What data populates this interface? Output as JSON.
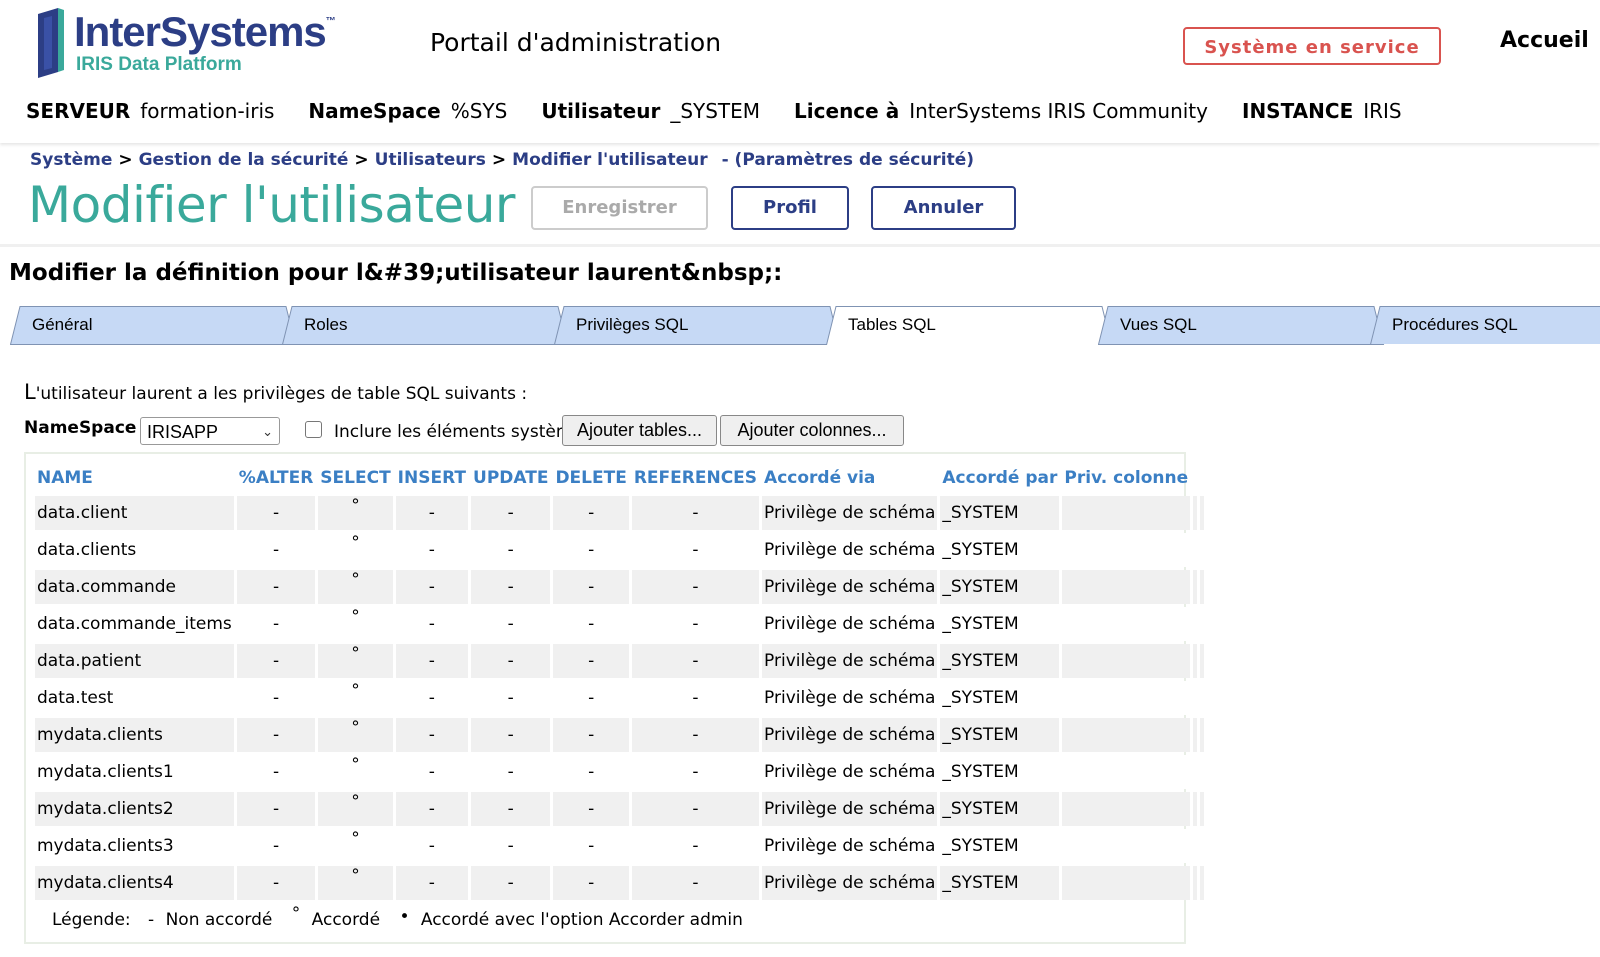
{
  "header": {
    "logo_name": "InterSystems",
    "logo_tm": "™",
    "logo_sub": "IRIS Data Platform",
    "portal_title": "Portail d'administration",
    "status_button": "Système en service",
    "home_link": "Accueil"
  },
  "info": [
    {
      "label": "SERVEUR",
      "value": "formation-iris"
    },
    {
      "label": "NameSpace",
      "value": "%SYS"
    },
    {
      "label": "Utilisateur",
      "value": "_SYSTEM"
    },
    {
      "label": "Licence à",
      "value": "InterSystems IRIS Community"
    },
    {
      "label": "INSTANCE",
      "value": "IRIS"
    }
  ],
  "breadcrumb": {
    "items": [
      "Système",
      "Gestion de la sécurité",
      "Utilisateurs",
      "Modifier l'utilisateur"
    ],
    "separator": ">",
    "suffix": "- (Paramètres de sécurité)"
  },
  "page_title": "Modifier l'utilisateur",
  "commands": {
    "save": "Enregistrer",
    "profile": "Profil",
    "cancel": "Annuler"
  },
  "definition_title": "Modifier la définition pour l&#39;utilisateur laurent&nbsp;:",
  "tabs": [
    "Général",
    "Roles",
    "Privilèges SQL",
    "Tables SQL",
    "Vues SQL",
    "Procédures SQL"
  ],
  "active_tab": "Tables SQL",
  "intro": {
    "first": "L",
    "rest": "'utilisateur laurent a les privilèges de table SQL suivants :"
  },
  "filters": {
    "namespace_label": "NameSpace",
    "namespace_value": "IRISAPP",
    "include_system_label": "Inclure les éléments système",
    "include_system_checked": false,
    "add_tables": "Ajouter tables...",
    "add_columns": "Ajouter colonnes..."
  },
  "table": {
    "columns": [
      "NAME",
      "%ALTER",
      "SELECT",
      "INSERT",
      "UPDATE",
      "DELETE",
      "REFERENCES",
      "Accordé via",
      "Accordé par",
      "Priv. colonne"
    ],
    "rows": [
      [
        "data.client",
        "-",
        "°",
        "-",
        "-",
        "-",
        "-",
        "Privilège de schéma",
        "_SYSTEM",
        ""
      ],
      [
        "data.clients",
        "-",
        "°",
        "-",
        "-",
        "-",
        "-",
        "Privilège de schéma",
        "_SYSTEM",
        ""
      ],
      [
        "data.commande",
        "-",
        "°",
        "-",
        "-",
        "-",
        "-",
        "Privilège de schéma",
        "_SYSTEM",
        ""
      ],
      [
        "data.commande_items",
        "-",
        "°",
        "-",
        "-",
        "-",
        "-",
        "Privilège de schéma",
        "_SYSTEM",
        ""
      ],
      [
        "data.patient",
        "-",
        "°",
        "-",
        "-",
        "-",
        "-",
        "Privilège de schéma",
        "_SYSTEM",
        ""
      ],
      [
        "data.test",
        "-",
        "°",
        "-",
        "-",
        "-",
        "-",
        "Privilège de schéma",
        "_SYSTEM",
        ""
      ],
      [
        "mydata.clients",
        "-",
        "°",
        "-",
        "-",
        "-",
        "-",
        "Privilège de schéma",
        "_SYSTEM",
        ""
      ],
      [
        "mydata.clients1",
        "-",
        "°",
        "-",
        "-",
        "-",
        "-",
        "Privilège de schéma",
        "_SYSTEM",
        ""
      ],
      [
        "mydata.clients2",
        "-",
        "°",
        "-",
        "-",
        "-",
        "-",
        "Privilège de schéma",
        "_SYSTEM",
        ""
      ],
      [
        "mydata.clients3",
        "-",
        "°",
        "-",
        "-",
        "-",
        "-",
        "Privilège de schéma",
        "_SYSTEM",
        ""
      ],
      [
        "mydata.clients4",
        "-",
        "°",
        "-",
        "-",
        "-",
        "-",
        "Privilège de schéma",
        "_SYSTEM",
        ""
      ]
    ]
  },
  "legend": {
    "title": "Légende:",
    "items": [
      {
        "symbol": "-",
        "label": "Non accordé"
      },
      {
        "symbol": "°",
        "label": "Accordé"
      },
      {
        "symbol": "•",
        "label": "Accordé avec l'option Accorder admin"
      }
    ]
  },
  "colors": {
    "brand_navy": "#2c3e85",
    "brand_teal": "#3aa99b",
    "status_red": "#d9534f",
    "tab_blue": "#c6d9f5",
    "header_link_blue": "#3b7fc4"
  },
  "icons": {
    "logo": "intersystems-logo-icon",
    "select": "chevron-down-icon"
  }
}
